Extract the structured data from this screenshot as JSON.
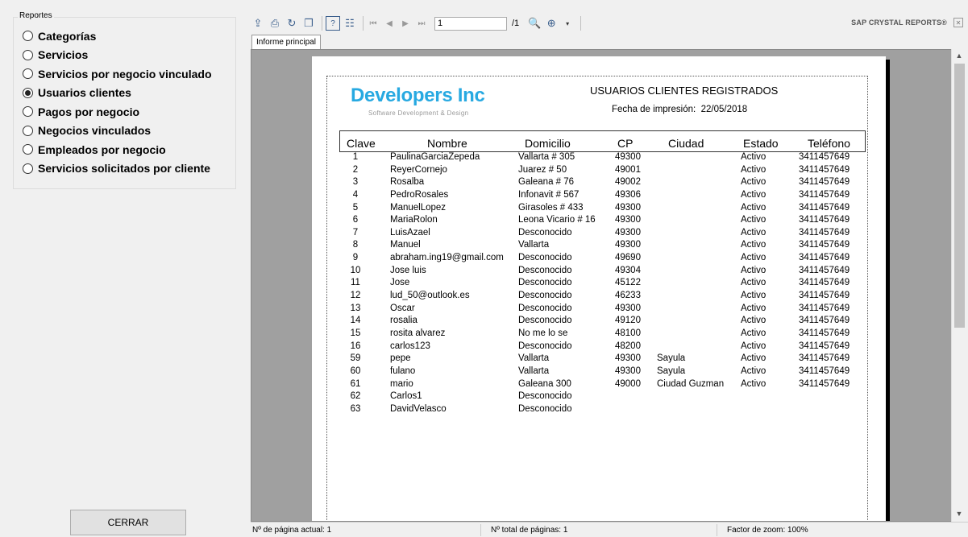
{
  "sidebar": {
    "group_title": "Reportes",
    "options": [
      {
        "label": "Categorías",
        "selected": false
      },
      {
        "label": "Servicios",
        "selected": false
      },
      {
        "label": "Servicios por negocio vinculado",
        "selected": false
      },
      {
        "label": "Usuarios clientes",
        "selected": true
      },
      {
        "label": "Pagos por negocio",
        "selected": false
      },
      {
        "label": "Negocios vinculados",
        "selected": false
      },
      {
        "label": "Empleados por negocio",
        "selected": false
      },
      {
        "label": "Servicios solicitados por cliente",
        "selected": false
      }
    ],
    "close_button": "CERRAR"
  },
  "toolbar": {
    "icons": [
      "export-icon",
      "print-icon",
      "refresh-icon",
      "copy-icon",
      "help-icon",
      "group-tree-icon"
    ],
    "page_value": "1",
    "page_total": "/1",
    "brand": "SAP CRYSTAL REPORTS®"
  },
  "tab": {
    "label": "Informe principal"
  },
  "report": {
    "logo_title": "Developers Inc",
    "logo_subtitle": "Software Development & Design",
    "title": "USUARIOS CLIENTES REGISTRADOS",
    "print_date_label": "Fecha de impresión:",
    "print_date": "22/05/2018",
    "columns": [
      "Clave",
      "Nombre",
      "Domicilio",
      "CP",
      "Ciudad",
      "Estado",
      "Teléfono"
    ],
    "rows": [
      [
        "1",
        "PaulinaGarciaZepeda",
        "Vallarta # 305",
        "49300",
        "",
        "Activo",
        "3411457649"
      ],
      [
        "2",
        "ReyerCornejo",
        "Juarez # 50",
        "49001",
        "",
        "Activo",
        "3411457649"
      ],
      [
        "3",
        "Rosalba",
        "Galeana # 76",
        "49002",
        "",
        "Activo",
        "3411457649"
      ],
      [
        "4",
        "PedroRosales",
        "Infonavit # 567",
        "49306",
        "",
        "Activo",
        "3411457649"
      ],
      [
        "5",
        "ManuelLopez",
        "Girasoles # 433",
        "49300",
        "",
        "Activo",
        "3411457649"
      ],
      [
        "6",
        "MariaRolon",
        "Leona Vicario # 16",
        "49300",
        "",
        "Activo",
        "3411457649"
      ],
      [
        "7",
        "LuisAzael",
        "Desconocido",
        "49300",
        "",
        "Activo",
        "3411457649"
      ],
      [
        "8",
        "Manuel",
        "Vallarta",
        "49300",
        "",
        "Activo",
        "3411457649"
      ],
      [
        "9",
        "abraham.ing19@gmail.com",
        "Desconocido",
        "49690",
        "",
        "Activo",
        "3411457649"
      ],
      [
        "10",
        "Jose luis",
        "Desconocido",
        "49304",
        "",
        "Activo",
        "3411457649"
      ],
      [
        "11",
        "Jose",
        "Desconocido",
        "45122",
        "",
        "Activo",
        "3411457649"
      ],
      [
        "12",
        "lud_50@outlook.es",
        "Desconocido",
        "46233",
        "",
        "Activo",
        "3411457649"
      ],
      [
        "13",
        "Oscar",
        "Desconocido",
        "49300",
        "",
        "Activo",
        "3411457649"
      ],
      [
        "14",
        "rosalia",
        "Desconocido",
        "49120",
        "",
        "Activo",
        "3411457649"
      ],
      [
        "15",
        "rosita alvarez",
        "No me lo se",
        "48100",
        "",
        "Activo",
        "3411457649"
      ],
      [
        "16",
        "carlos123",
        "Desconocido",
        "48200",
        "",
        "Activo",
        "3411457649"
      ],
      [
        "59",
        "pepe",
        "Vallarta",
        "49300",
        "Sayula",
        "Activo",
        "3411457649"
      ],
      [
        "60",
        "fulano",
        "Vallarta",
        "49300",
        "Sayula",
        "Activo",
        "3411457649"
      ],
      [
        "61",
        "mario",
        "Galeana 300",
        "49000",
        "Ciudad Guzman",
        "Activo",
        "3411457649"
      ],
      [
        "62",
        "Carlos1",
        "Desconocido",
        "",
        "",
        "",
        ""
      ],
      [
        "63",
        "DavidVelasco",
        "Desconocido",
        "",
        "",
        "",
        ""
      ]
    ]
  },
  "status": {
    "current_page": "Nº de página actual: 1",
    "total_pages": "Nº total de páginas: 1",
    "zoom": "Factor de zoom: 100%"
  }
}
